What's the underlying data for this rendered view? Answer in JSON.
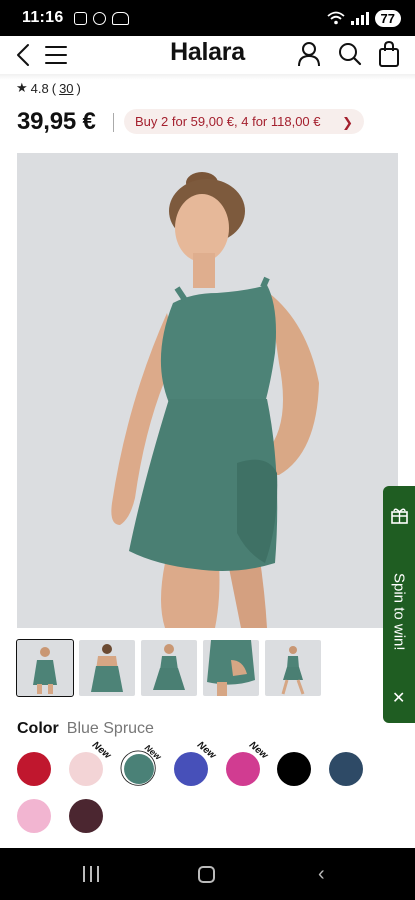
{
  "status_bar": {
    "time": "11:16",
    "battery": "77",
    "icons": [
      "screenshot-icon",
      "chat-icon",
      "people-icon",
      "wifi-icon",
      "signal-icon",
      "battery-icon"
    ]
  },
  "nav": {
    "brand": "Halara",
    "icons": [
      "back-arrow-icon",
      "hamburger-menu-icon",
      "account-icon",
      "search-icon",
      "shopping-bag-icon"
    ]
  },
  "product": {
    "rating": "4.8",
    "review_count": "30",
    "rating_open": "(",
    "rating_close": ")",
    "price": "39,95 €",
    "promo": "Buy 2 for 59,00 €, 4 for 118,00 €",
    "promo_icon": "chevron-right-icon"
  },
  "spin_widget": {
    "label": "Spin to win!",
    "close": "✕",
    "icon": "gift-icon",
    "color": "#1f5d22"
  },
  "gallery": {
    "thumbnail_count": 5,
    "active_index": 0
  },
  "color": {
    "label": "Color",
    "selected_name": "Blue Spruce",
    "new_label": "New",
    "swatches": [
      {
        "color": "#c0172e",
        "is_new": false,
        "selected": false
      },
      {
        "color": "#f3d4d6",
        "is_new": true,
        "selected": false
      },
      {
        "color": "#4a8177",
        "is_new": true,
        "selected": true
      },
      {
        "color": "#4750b9",
        "is_new": true,
        "selected": false
      },
      {
        "color": "#d13c91",
        "is_new": true,
        "selected": false
      },
      {
        "color": "#000000",
        "is_new": false,
        "selected": false
      },
      {
        "color": "#2e4a66",
        "is_new": false,
        "selected": false
      },
      {
        "color": "#f2b5d1",
        "is_new": false,
        "selected": false
      },
      {
        "color": "#4b2630",
        "is_new": false,
        "selected": false
      }
    ]
  },
  "colors": {
    "promo_text": "#a4202e",
    "dress": "#4d8377",
    "image_bg": "#dbdde0"
  },
  "system_nav": {
    "icons": [
      "recent-apps-icon",
      "home-icon",
      "back-icon"
    ]
  }
}
